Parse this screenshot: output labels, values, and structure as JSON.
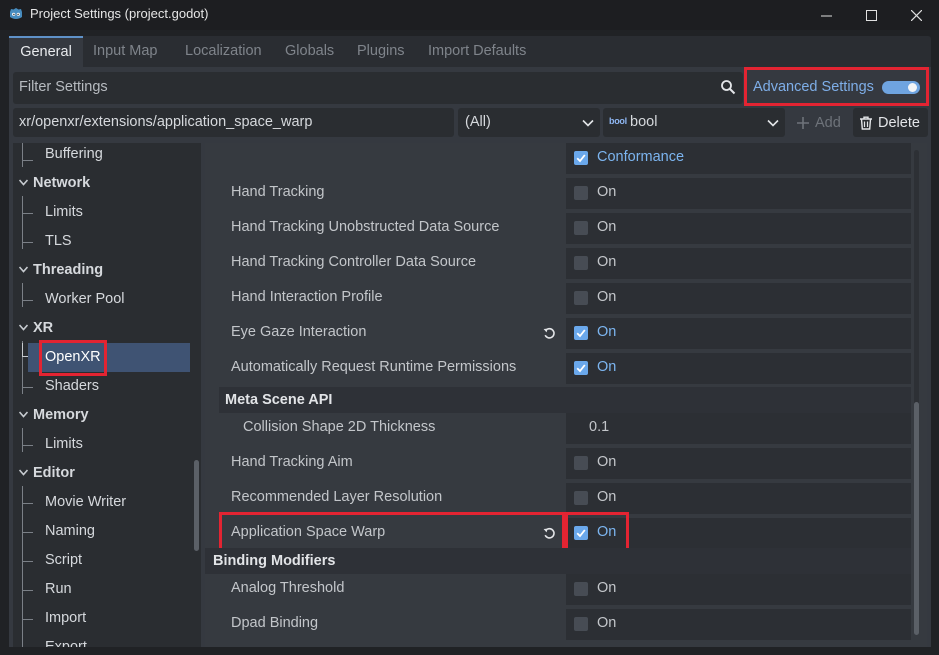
{
  "window": {
    "title": "Project Settings (project.godot)",
    "logo_icon": "godot-icon"
  },
  "tabs": [
    {
      "label": "General",
      "active": true
    },
    {
      "label": "Input Map"
    },
    {
      "label": "Localization"
    },
    {
      "label": "Globals"
    },
    {
      "label": "Plugins"
    },
    {
      "label": "Import Defaults"
    }
  ],
  "filter": {
    "placeholder": "Filter Settings",
    "search_icon": "search-icon"
  },
  "advanced": {
    "label": "Advanced Settings",
    "enabled": true
  },
  "property_bar": {
    "path": "xr/openxr/extensions/application_space_warp",
    "scope": "(All)",
    "type": "bool",
    "add_label": "Add",
    "delete_label": "Delete"
  },
  "tree": [
    {
      "label": "Buffering",
      "kind": "leaf"
    },
    {
      "label": "Network",
      "kind": "cat"
    },
    {
      "label": "Limits",
      "kind": "leaf"
    },
    {
      "label": "TLS",
      "kind": "leaf"
    },
    {
      "label": "Threading",
      "kind": "cat"
    },
    {
      "label": "Worker Pool",
      "kind": "leaf"
    },
    {
      "label": "XR",
      "kind": "cat"
    },
    {
      "label": "OpenXR",
      "kind": "leaf",
      "selected": true
    },
    {
      "label": "Shaders",
      "kind": "leaf"
    },
    {
      "label": "Memory",
      "kind": "cat"
    },
    {
      "label": "Limits",
      "kind": "leaf"
    },
    {
      "label": "Editor",
      "kind": "cat"
    },
    {
      "label": "Movie Writer",
      "kind": "leaf"
    },
    {
      "label": "Naming",
      "kind": "leaf"
    },
    {
      "label": "Script",
      "kind": "leaf"
    },
    {
      "label": "Run",
      "kind": "leaf"
    },
    {
      "label": "Import",
      "kind": "leaf"
    },
    {
      "label": "Export",
      "kind": "leaf"
    }
  ],
  "inspector": {
    "top_value": {
      "label": "Conformance",
      "checked": true
    },
    "rows": [
      {
        "name": "Hand Tracking",
        "value": "On",
        "checked": false
      },
      {
        "name": "Hand Tracking Unobstructed Data Source",
        "value": "On",
        "checked": false
      },
      {
        "name": "Hand Tracking Controller Data Source",
        "value": "On",
        "checked": false
      },
      {
        "name": "Hand Interaction Profile",
        "value": "On",
        "checked": false
      },
      {
        "name": "Eye Gaze Interaction",
        "value": "On",
        "checked": true,
        "revert": true
      },
      {
        "name": "Automatically Request Runtime Permissions",
        "value": "On",
        "checked": true
      }
    ],
    "section_meta": "Meta Scene API",
    "meta_row": {
      "name": "Collision Shape 2D Thickness",
      "value": "0.1"
    },
    "rows2": [
      {
        "name": "Hand Tracking Aim",
        "value": "On",
        "checked": false
      },
      {
        "name": "Recommended Layer Resolution",
        "value": "On",
        "checked": false
      },
      {
        "name": "Application Space Warp",
        "value": "On",
        "checked": true,
        "revert": true
      }
    ],
    "section_binding": "Binding Modifiers",
    "rows3": [
      {
        "name": "Analog Threshold",
        "value": "On",
        "checked": false
      },
      {
        "name": "Dpad Binding",
        "value": "On",
        "checked": false
      }
    ]
  }
}
